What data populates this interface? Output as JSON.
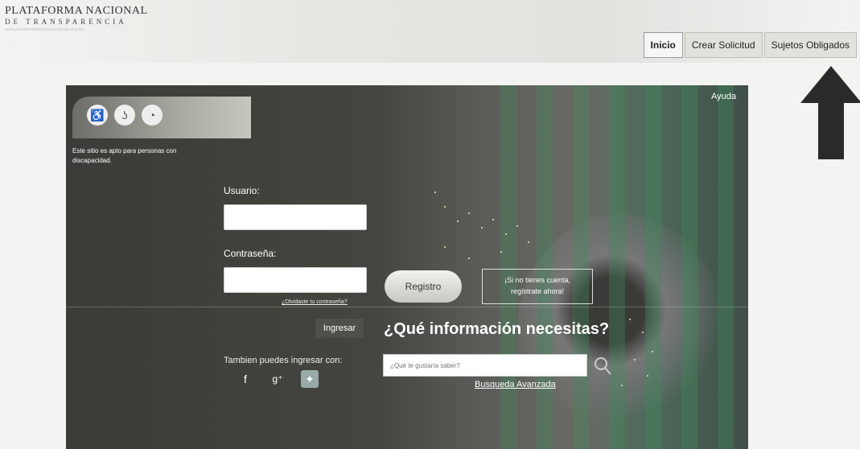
{
  "header": {
    "logo_line1": "PLATAFORMA NACIONAL",
    "logo_line2": "DE TRANSPARENCIA",
    "logo_line3": "www.plataformadetransparencia.org.mx",
    "nav": [
      {
        "label": "Inicio",
        "active": true
      },
      {
        "label": "Crear Solicitud",
        "active": false
      },
      {
        "label": "Sujetos Obligados",
        "active": false
      }
    ]
  },
  "hero": {
    "help_link": "Ayuda",
    "accessibility_icons": [
      "wheelchair-icon",
      "hearing-icon",
      "low-vision-icon"
    ],
    "accessibility_caption": "Este sitio es apto para personas con discapacidad.",
    "login": {
      "username_label": "Usuario:",
      "username_value": "",
      "password_label": "Contraseña:",
      "password_value": "",
      "forgot_link": "¿Olvidaste tu contraseña?",
      "submit_label": "Ingresar",
      "social_label": "Tambien puedes ingresar con:",
      "social": [
        "facebook-icon",
        "google-plus-icon",
        "twitter-icon"
      ]
    },
    "register": {
      "button_label": "Registro",
      "prompt_line1": "¡Si no tienes cuenta,",
      "prompt_line2": "regístrate ahora!"
    },
    "search": {
      "heading": "¿Qué información necesitas?",
      "placeholder": "¿Qué te gustaría saber?",
      "advanced_link": "Busqueda Avanzada"
    }
  },
  "colors": {
    "hero_base": "#45453f",
    "accent_green": "#3c8c5a",
    "arrow": "#2a2a2a"
  }
}
